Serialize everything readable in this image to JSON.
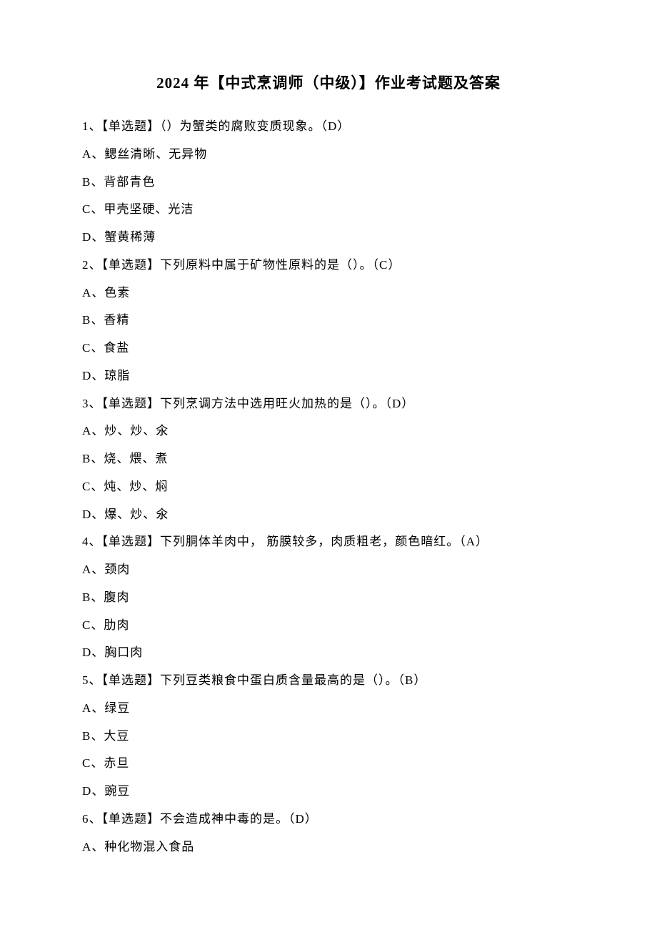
{
  "title": "2024 年【中式烹调师（中级）】作业考试题及答案",
  "lines": [
    "1、【单选题】（）为蟹类的腐败变质现象。（D）",
    "A、鳃丝清晰、无异物",
    "B、背部青色",
    "C、甲壳坚硬、光洁",
    "D、蟹黄稀薄",
    "2、【单选题】下列原料中属于矿物性原料的是（）。（C）",
    "A、色素",
    "B、香精",
    "C、食盐",
    "D、琼脂",
    "3、【单选题】下列烹调方法中选用旺火加热的是（）。（D）",
    "A、炒、炒、氽",
    "B、烧、煨、煮",
    "C、炖、炒、焖",
    "D、爆、炒、氽",
    "4、【单选题】下列胴体羊肉中， 筋膜较多，肉质粗老，颜色暗红。（A）",
    "A、颈肉",
    "B、腹肉",
    "C、肋肉",
    "D、胸口肉",
    "5、【单选题】下列豆类粮食中蛋白质含量最高的是（）。（B）",
    "A、绿豆",
    "B、大豆",
    "C、赤旦",
    "D、豌豆",
    "6、【单选题】不会造成神中毒的是。（D）",
    "A、种化物混入食品"
  ]
}
